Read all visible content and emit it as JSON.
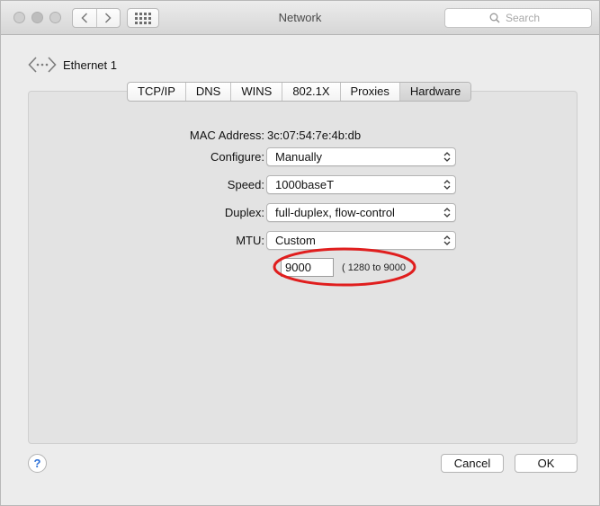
{
  "window": {
    "title": "Network",
    "back_icon": "chevron-left-icon",
    "forward_icon": "chevron-right-icon",
    "grid_icon": "show-all-grid-icon",
    "search": {
      "placeholder": "Search",
      "value": ""
    }
  },
  "interface": {
    "name": "Ethernet 1",
    "icon": "ethernet-icon"
  },
  "tabs": [
    {
      "label": "TCP/IP",
      "active": false
    },
    {
      "label": "DNS",
      "active": false
    },
    {
      "label": "WINS",
      "active": false
    },
    {
      "label": "802.1X",
      "active": false
    },
    {
      "label": "Proxies",
      "active": false
    },
    {
      "label": "Hardware",
      "active": true
    }
  ],
  "hardware": {
    "mac": {
      "label": "MAC Address:",
      "value": "3c:07:54:7e:4b:db"
    },
    "configure": {
      "label": "Configure:",
      "value": "Manually"
    },
    "speed": {
      "label": "Speed:",
      "value": "1000baseT"
    },
    "duplex": {
      "label": "Duplex:",
      "value": "full-duplex, flow-control"
    },
    "mtu": {
      "label": "MTU:",
      "value": "Custom",
      "custom_value": "9000",
      "range": "( 1280 to 9000"
    }
  },
  "annotation": {
    "highlight_color": "#e01e1e"
  },
  "buttons": {
    "help": "?",
    "cancel": "Cancel",
    "ok": "OK"
  },
  "colors": {
    "accent": "#2a6fd8",
    "panel": "#e3e3e3",
    "window": "#ececec"
  }
}
